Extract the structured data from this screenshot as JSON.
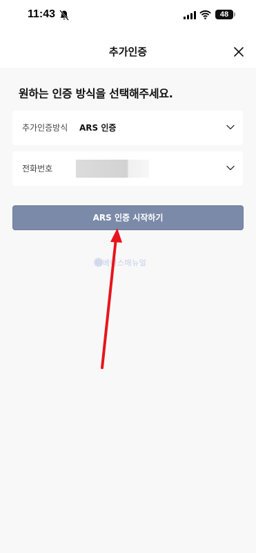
{
  "status_bar": {
    "time": "11:43",
    "battery": "48"
  },
  "nav": {
    "title": "추가인증"
  },
  "main": {
    "heading": "원하는 인증 방식을 선택해주세요.",
    "method_select": {
      "label": "추가인증방식",
      "value": "ARS 인증"
    },
    "phone_select": {
      "label": "전화번호"
    },
    "start_button_label": "ARS 인증 시작하기",
    "watermark": "이베이스매뉴얼"
  },
  "colors": {
    "button_bg": "#7b8aa8",
    "background": "#f8f8f8",
    "annotation_arrow": "#e8141c"
  },
  "icons": [
    "bell-slash-icon",
    "signal-icon",
    "wifi-icon",
    "battery-icon",
    "close-icon",
    "chevron-down-icon"
  ]
}
